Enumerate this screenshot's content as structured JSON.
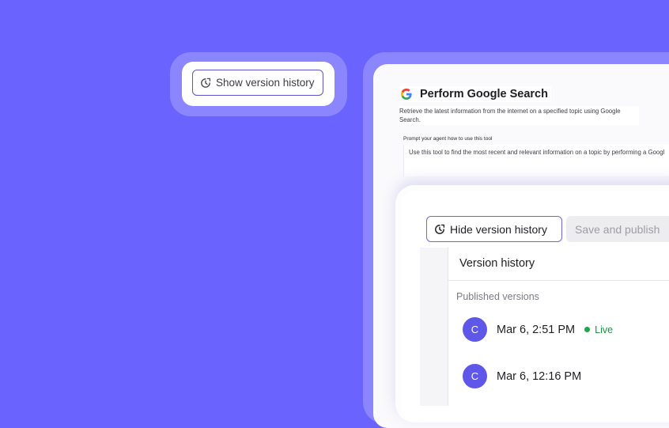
{
  "show_history": {
    "label": "Show version history",
    "icon": "history-clock-icon"
  },
  "tool": {
    "icon": "google-icon",
    "title": "Perform Google Search",
    "description": "Retrieve the latest information from the internet on a specified topic using Google Search.",
    "prompt_label": "Prompt your agent how to use this tool",
    "prompt_text": "Use this tool to find the most recent and relevant information on a topic by performing a Googl"
  },
  "toolbar": {
    "hide_history_label": "Hide version history",
    "save_publish_label": "Save and publish"
  },
  "version_history": {
    "title": "Version history",
    "section_label": "Published versions",
    "versions": [
      {
        "avatar": "C",
        "date": "Mar 6, 2:51 PM",
        "status": "Live"
      },
      {
        "avatar": "C",
        "date": "Mar 6, 12:16 PM",
        "status": ""
      }
    ]
  },
  "colors": {
    "background": "#6B63FE",
    "accent": "#5F57E8",
    "live": "#1FA54B"
  }
}
